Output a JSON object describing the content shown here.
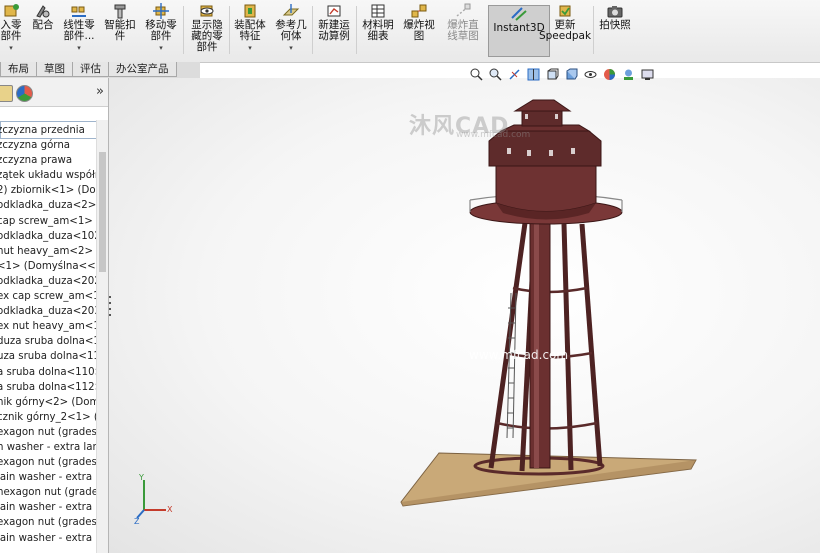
{
  "ribbon": {
    "buttons": [
      {
        "label": "入零\n部件",
        "has_dropdown": true
      },
      {
        "label": "配合",
        "has_dropdown": false
      },
      {
        "label": "线性零\n部件...",
        "has_dropdown": true
      },
      {
        "label": "智能扣\n件",
        "has_dropdown": false
      },
      {
        "label": "移动零\n部件",
        "has_dropdown": true
      },
      {
        "label": "显示隐\n藏的零\n部件",
        "has_dropdown": false
      },
      {
        "label": "装配体\n特征",
        "has_dropdown": true
      },
      {
        "label": "参考几\n何体",
        "has_dropdown": true
      },
      {
        "label": "新建运\n动算例",
        "has_dropdown": false
      },
      {
        "label": "材料明\n细表",
        "has_dropdown": false
      },
      {
        "label": "爆炸视\n图",
        "has_dropdown": false
      },
      {
        "label": "爆炸直\n线草图",
        "has_dropdown": false
      },
      {
        "label": "Instant3D",
        "has_dropdown": false
      },
      {
        "label": "更新\nSpeedpak",
        "has_dropdown": false
      },
      {
        "label": "拍快照",
        "has_dropdown": false
      }
    ]
  },
  "tabs": [
    "布局",
    "草图",
    "评估",
    "办公室产品"
  ],
  "panel": {
    "expand_glyph": "»",
    "tree_items": [
      "zczyzna przednia",
      "zczyzna górna",
      "zczyzna prawa",
      "zątek układu współr",
      "2) zbiornik<1> (Don",
      "odkladka_duza<2>",
      "cap screw_am<1> (",
      "odkladka_duza<102",
      "nut heavy_am<2> (E",
      "<1> (Domyślna<<D",
      "odkladka_duza<202",
      "ex cap screw_am<1",
      "odkladka_duza<203",
      "ex nut heavy_am<10",
      "duza sruba dolna<1>",
      "uza sruba dolna<11",
      "a sruba dolna<110>",
      "a sruba dolna<112>",
      "nik górny<2> (Dom",
      "cznik górny_2<1> (",
      "exagon nut (grades c)",
      "n washer - extra larg",
      "exagon nut (grades c)",
      "lain washer - extra l",
      "hexagon nut (grades",
      "lain washer - extra l",
      "exagon nut (grades",
      "lain washer - extra l"
    ]
  },
  "viewport": {
    "watermark_logo": "沐风CAD",
    "watermark_url": "www.mfcad.com",
    "center_watermark": "www.mfcad.com",
    "triad_labels": [
      "Y",
      "X",
      "Z"
    ]
  },
  "colors": {
    "tower": "#5a2a2a",
    "base": "#c9a978",
    "selected_button": "#cfcfcf"
  }
}
